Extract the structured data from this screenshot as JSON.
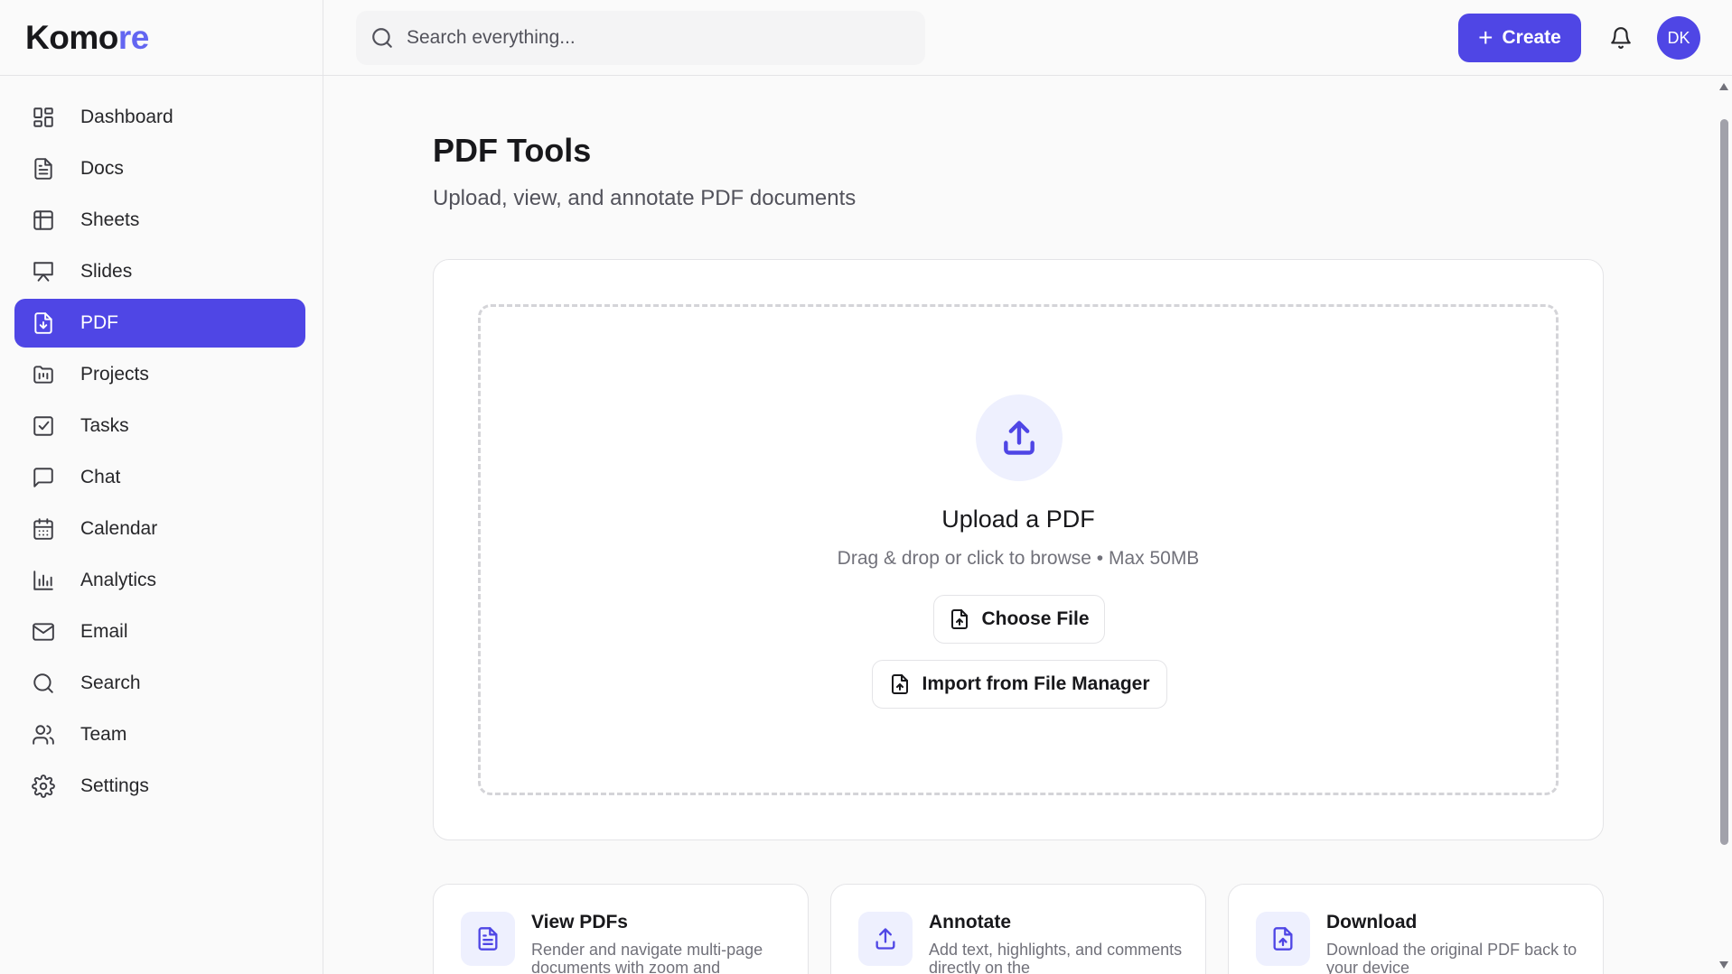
{
  "app": {
    "brand_prefix": "Komo",
    "brand_suffix": "re",
    "accent_color": "#4f46e5"
  },
  "sidebar": {
    "items": [
      {
        "label": "Dashboard",
        "icon": "dashboard-icon",
        "active": false
      },
      {
        "label": "Docs",
        "icon": "document-icon",
        "active": false
      },
      {
        "label": "Sheets",
        "icon": "table-icon",
        "active": false
      },
      {
        "label": "Slides",
        "icon": "presentation-icon",
        "active": false
      },
      {
        "label": "PDF",
        "icon": "pdf-icon",
        "active": true
      },
      {
        "label": "Projects",
        "icon": "folder-icon",
        "active": false
      },
      {
        "label": "Tasks",
        "icon": "checkbox-icon",
        "active": false
      },
      {
        "label": "Chat",
        "icon": "chat-icon",
        "active": false
      },
      {
        "label": "Calendar",
        "icon": "calendar-icon",
        "active": false
      },
      {
        "label": "Analytics",
        "icon": "bar-chart-icon",
        "active": false
      },
      {
        "label": "Email",
        "icon": "mail-icon",
        "active": false
      },
      {
        "label": "Search",
        "icon": "search-icon",
        "active": false
      },
      {
        "label": "Team",
        "icon": "users-icon",
        "active": false
      },
      {
        "label": "Settings",
        "icon": "gear-icon",
        "active": false
      }
    ]
  },
  "topbar": {
    "search_placeholder": "Search everything...",
    "create_label": "Create",
    "avatar_initials": "DK"
  },
  "main": {
    "title": "PDF Tools",
    "subtitle": "Upload, view, and annotate PDF documents",
    "upload": {
      "title": "Upload a PDF",
      "hint": "Drag & drop or click to browse • Max 50MB",
      "choose_label": "Choose File",
      "import_label": "Import from File Manager"
    },
    "features": [
      {
        "title": "View PDFs",
        "description": "Render and navigate multi-page documents with zoom and",
        "icon": "document-icon"
      },
      {
        "title": "Annotate",
        "description": "Add text, highlights, and comments directly on the",
        "icon": "upload-icon"
      },
      {
        "title": "Download",
        "description": "Download the original PDF back to your device",
        "icon": "file-upload-icon"
      }
    ]
  }
}
